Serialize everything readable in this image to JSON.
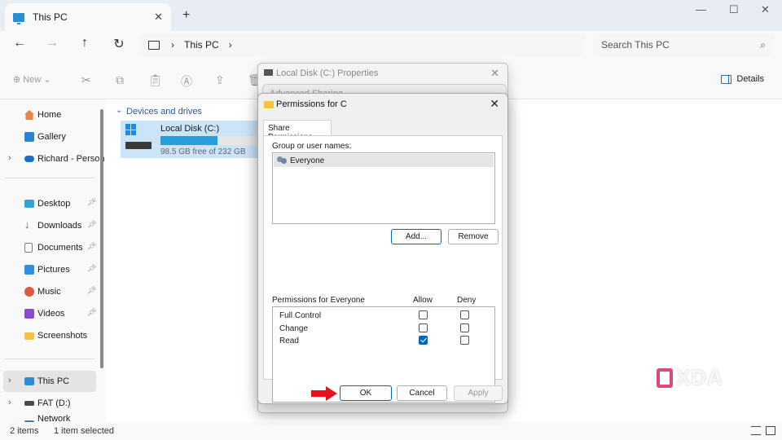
{
  "window": {
    "tab_title": "This PC",
    "new_tab": "+",
    "tab_close": "✕",
    "min": "—",
    "max": "☐",
    "close": "✕"
  },
  "nav": {
    "back": "←",
    "forward": "→",
    "up": "↑",
    "refresh": "↻"
  },
  "address": {
    "crumb": "This PC",
    "sep": "›",
    "sep2": "›"
  },
  "search": {
    "placeholder": "Search This PC",
    "icon": "⌕"
  },
  "toolbar": {
    "new_label": "New",
    "details_label": "Details"
  },
  "sidebar": {
    "items": [
      {
        "label": "Home"
      },
      {
        "label": "Gallery"
      },
      {
        "label": "Richard - Person"
      },
      {
        "label": "Desktop"
      },
      {
        "label": "Downloads"
      },
      {
        "label": "Documents"
      },
      {
        "label": "Pictures"
      },
      {
        "label": "Music"
      },
      {
        "label": "Videos"
      },
      {
        "label": "Screenshots"
      },
      {
        "label": "This PC"
      },
      {
        "label": "FAT (D:)"
      },
      {
        "label": "Network"
      }
    ]
  },
  "main": {
    "group_title": "Devices and drives",
    "drive": {
      "name": "Local Disk (C:)",
      "free": "98.5 GB free of 232 GB",
      "used_fraction": 0.575
    }
  },
  "statusbar": {
    "count": "2 items",
    "selected": "1 item selected"
  },
  "dialogs": {
    "properties_title": "Local Disk (C:) Properties",
    "advanced_title": "Advanced Sharing",
    "permissions": {
      "title": "Permissions for C",
      "tab": "Share Permissions",
      "group_label": "Group or user names:",
      "users": [
        "Everyone"
      ],
      "add_button": "Add...",
      "remove_button": "Remove",
      "perm_label": "Permissions for Everyone",
      "allow_label": "Allow",
      "deny_label": "Deny",
      "rows": [
        {
          "name": "Full Control",
          "allow": false,
          "deny": false
        },
        {
          "name": "Change",
          "allow": false,
          "deny": false
        },
        {
          "name": "Read",
          "allow": true,
          "deny": false
        }
      ],
      "ok_button": "OK",
      "cancel_button": "Cancel",
      "apply_button": "Apply"
    }
  },
  "watermark": {
    "text": "XDA"
  },
  "colors": {
    "accent": "#0067c0",
    "drive_bar": "#26a0da",
    "arrow": "#e3121b"
  }
}
